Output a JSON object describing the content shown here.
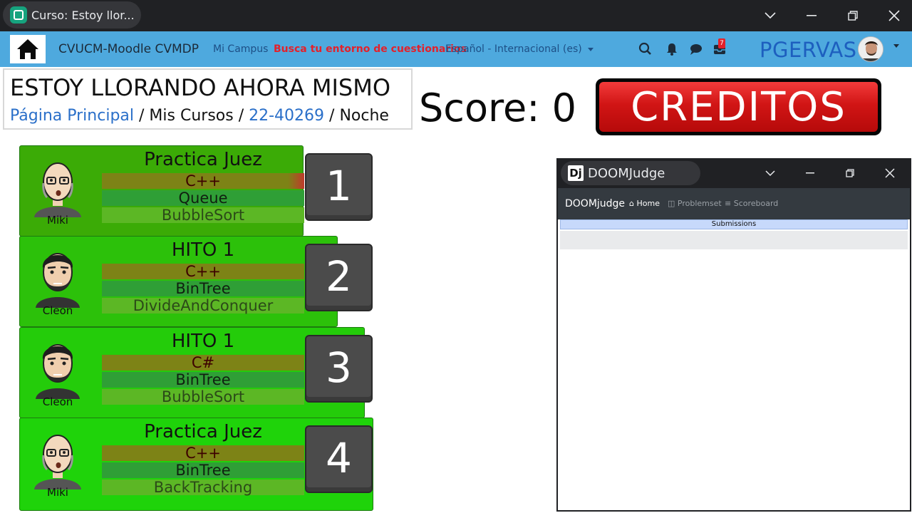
{
  "browser": {
    "tab_title": "Curso: Estoy llor..."
  },
  "navbar": {
    "brand": "CVUCM-Moodle CVMDP",
    "link_campus": "Mi Campus",
    "link_highlight": "Busca tu entorno de cuestionarios",
    "language": "Español - Internacional (es)",
    "notification_badge": "7",
    "username": "PGERVAS"
  },
  "course": {
    "title": "ESTOY LLORANDO AHORA MISMO",
    "breadcrumb": {
      "home": "Página Principal",
      "sep1": " / ",
      "my_courses": "Mis Cursos",
      "sep2": " / ",
      "course_code": "22-40269",
      "sep3": " / ",
      "section": "Noche"
    }
  },
  "score_label": "Score: 0",
  "credits_button": "CREDITOS",
  "cards": [
    {
      "number": "1",
      "character": "Miki",
      "title": "Practica Juez",
      "language": "C++",
      "structure": "Queue",
      "algorithm": "BubbleSort"
    },
    {
      "number": "2",
      "character": "Cleon",
      "title": "HITO 1",
      "language": "C++",
      "structure": "BinTree",
      "algorithm": "DivideAndConquer"
    },
    {
      "number": "3",
      "character": "Cleon",
      "title": "HITO 1",
      "language": "C#",
      "structure": "BinTree",
      "algorithm": "BubbleSort"
    },
    {
      "number": "4",
      "character": "Miki",
      "title": "Practica Juez",
      "language": "C++",
      "structure": "BinTree",
      "algorithm": "BackTracking"
    }
  ],
  "domjudge": {
    "logo": "Dj",
    "window_title": "DOOMJudge",
    "brand": "DOOMjudge",
    "nav": {
      "home": "Home",
      "problemset": "Problemset",
      "scoreboard": "Scoreboard"
    },
    "submissions_header": "Submissions"
  },
  "colors": {
    "navbar": "#4ea9de",
    "card_green": "#22c40a",
    "credits_red": "#d11515"
  }
}
